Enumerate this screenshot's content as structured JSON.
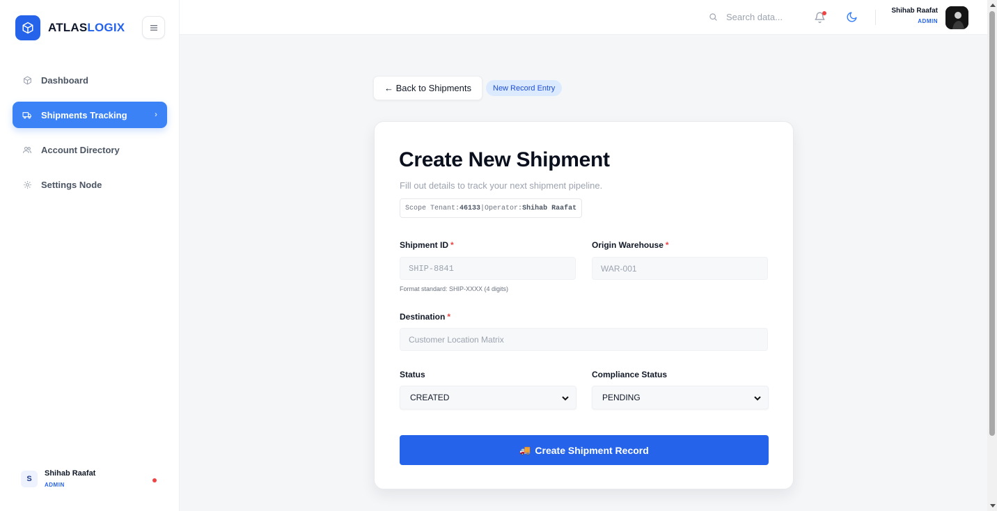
{
  "brand": {
    "prefix": "ATLAS",
    "suffix": "LOGIX"
  },
  "sidebar": {
    "items": [
      {
        "label": "Dashboard",
        "icon": "cube-icon",
        "active": false
      },
      {
        "label": "Shipments Tracking",
        "icon": "truck-icon",
        "active": true
      },
      {
        "label": "Account Directory",
        "icon": "users-icon",
        "active": false
      },
      {
        "label": "Settings Node",
        "icon": "gear-icon",
        "active": false
      }
    ],
    "user": {
      "initial": "S",
      "name": "Shihab Raafat",
      "role": "ADMIN"
    }
  },
  "header": {
    "search_placeholder": "Search data...",
    "user": {
      "name": "Shihab Raafat",
      "role": "ADMIN"
    }
  },
  "main": {
    "back_label": "← Back to Shipments",
    "badge": "New Record Entry"
  },
  "form": {
    "title": "Create New Shipment",
    "subtitle": "Fill out details to track your next shipment pipeline.",
    "scope": {
      "tenant_label": "Scope Tenant:",
      "tenant_value": "46133",
      "separator": "|",
      "operator_label": "Operator:",
      "operator_value": "Shihab Raafat"
    },
    "shipment_id": {
      "label": "Shipment ID",
      "required_mark": "*",
      "placeholder": "SHIP-8841",
      "hint": "Format standard: SHIP-XXXX (4 digits)"
    },
    "origin": {
      "label": "Origin Warehouse",
      "required_mark": "*",
      "placeholder": "WAR-001"
    },
    "destination": {
      "label": "Destination",
      "required_mark": "*",
      "placeholder": "Customer Location Matrix"
    },
    "status": {
      "label": "Status",
      "value": "CREATED"
    },
    "compliance": {
      "label": "Compliance Status",
      "value": "PENDING"
    },
    "submit": {
      "icon": "🚚",
      "label": "Create Shipment Record"
    }
  },
  "colors": {
    "accent": "#2563eb",
    "sidebar_active": "#3b82f6",
    "alert": "#ef4444"
  }
}
